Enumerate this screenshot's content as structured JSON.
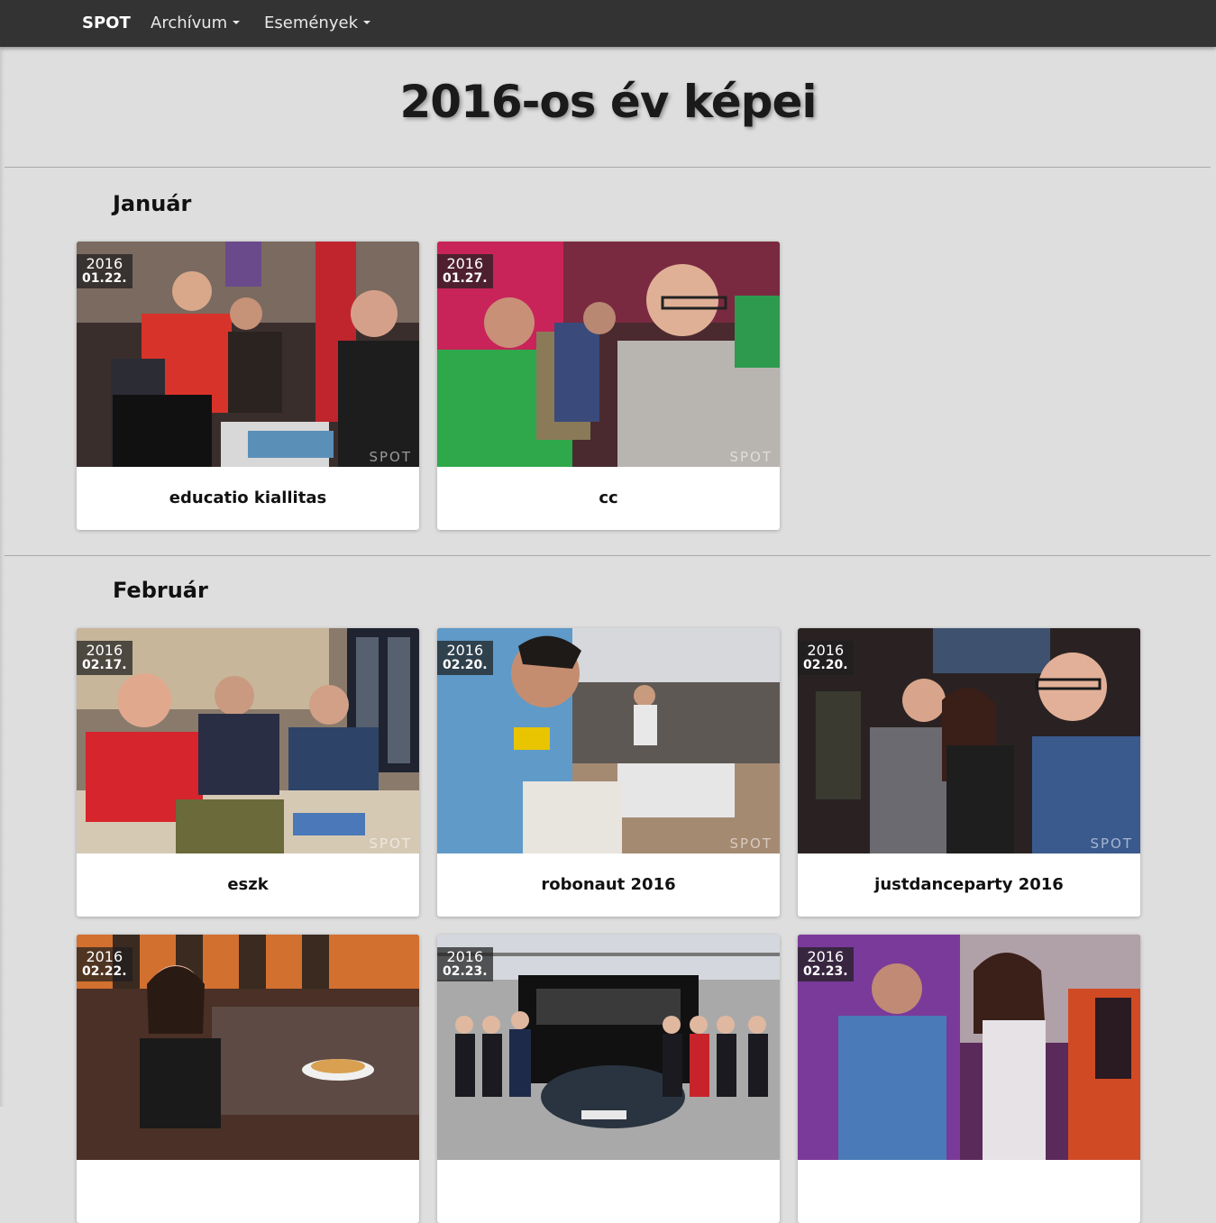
{
  "nav": {
    "brand": "SPOT",
    "items": [
      {
        "label": "Archívum"
      },
      {
        "label": "Események"
      }
    ]
  },
  "page": {
    "title": "2016-os év képei"
  },
  "months": [
    {
      "name": "Január",
      "albums": [
        {
          "title": "educatio kiallitas",
          "year": "2016",
          "day": "01.22.",
          "watermark": "SPOT"
        },
        {
          "title": "cc",
          "year": "2016",
          "day": "01.27.",
          "watermark": "SPOT"
        }
      ]
    },
    {
      "name": "Február",
      "albums": [
        {
          "title": "eszk",
          "year": "2016",
          "day": "02.17.",
          "watermark": "SPOT"
        },
        {
          "title": "robonaut 2016",
          "year": "2016",
          "day": "02.20.",
          "watermark": "SPOT"
        },
        {
          "title": "justdanceparty 2016",
          "year": "2016",
          "day": "02.20.",
          "watermark": "SPOT"
        },
        {
          "title": "",
          "year": "2016",
          "day": "02.22.",
          "watermark": ""
        },
        {
          "title": "",
          "year": "2016",
          "day": "02.23.",
          "watermark": ""
        },
        {
          "title": "",
          "year": "2016",
          "day": "02.23.",
          "watermark": ""
        }
      ]
    }
  ]
}
